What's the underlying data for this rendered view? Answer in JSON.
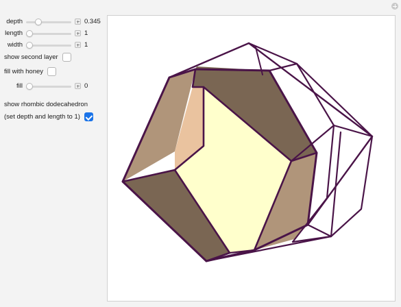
{
  "controls": {
    "depth": {
      "label": "depth",
      "value_text": "0.345",
      "fraction": 0.23
    },
    "length": {
      "label": "length",
      "value_text": "1",
      "fraction": 0.0
    },
    "width": {
      "label": "width",
      "value_text": "1",
      "fraction": 0.0
    },
    "second_layer": {
      "label": "show second layer",
      "checked": false
    },
    "fill_honey": {
      "label": "fill with honey",
      "checked": false
    },
    "fill": {
      "label": "fill",
      "value_text": "0",
      "fraction": 0.0
    },
    "rhombic": {
      "label_line1": "show rhombic dodecahedron",
      "label_line2": "(set depth and length to 1)",
      "checked": true
    }
  },
  "colors": {
    "edge": "#4a1448",
    "dark_face": "#7a6653",
    "tan_face": "#b0957a",
    "peach_face": "#eac39f",
    "cream_face": "#ffffcc",
    "accent": "#1a73e8"
  }
}
